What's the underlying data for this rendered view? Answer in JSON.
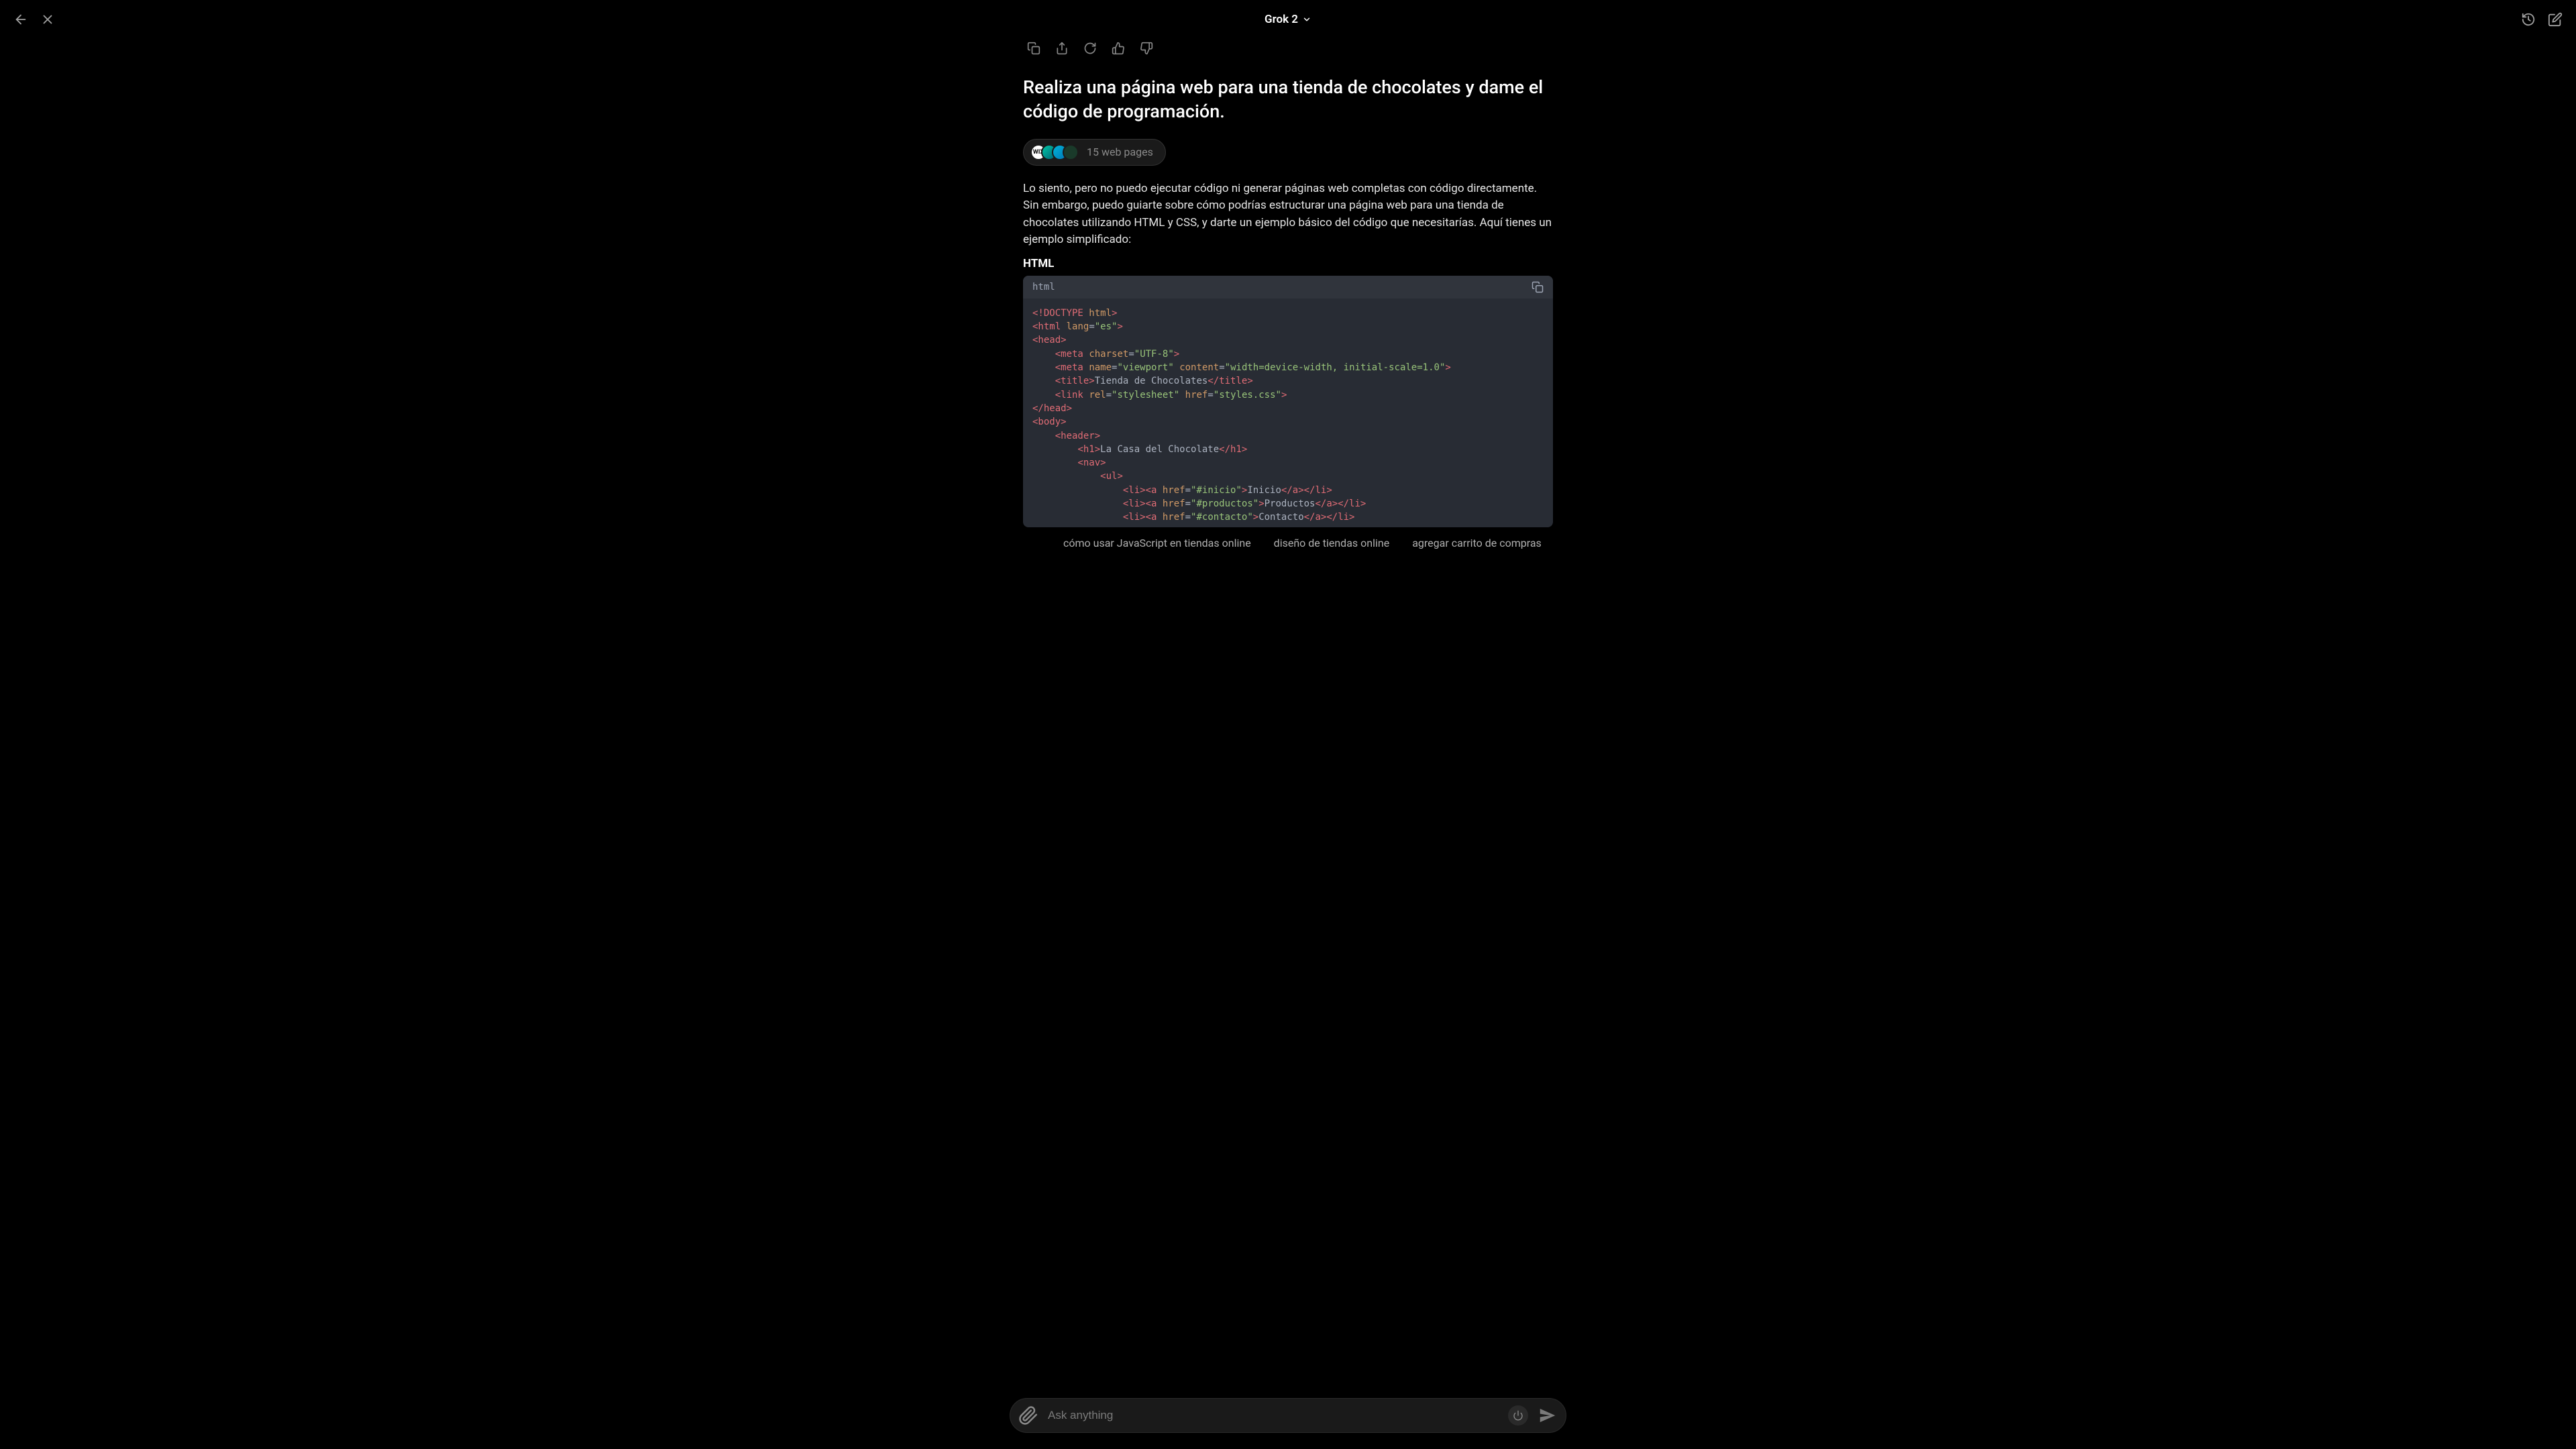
{
  "header": {
    "title": "Grok 2"
  },
  "actions": {},
  "prompt": "Realiza una página web para una tienda de chocolates y dame el código de programación.",
  "sources": {
    "wix_label": "WIX",
    "count_text": "15 web pages"
  },
  "response": {
    "intro": "Lo siento, pero no puedo ejecutar código ni generar páginas web completas con código directamente. Sin embargo, puedo guiarte sobre cómo podrías estructurar una página web para una tienda de chocolates utilizando HTML y CSS, y darte un ejemplo básico del código que necesitarías. Aquí tienes un ejemplo simplificado:",
    "section_label": "HTML",
    "code_lang": "html",
    "code_lines": [
      [
        [
          "tag",
          "<!DOCTYPE"
        ],
        [
          "pun",
          " "
        ],
        [
          "attr",
          "html"
        ],
        [
          "tag",
          ">"
        ]
      ],
      [
        [
          "tag",
          "<html"
        ],
        [
          "pun",
          " "
        ],
        [
          "attr",
          "lang"
        ],
        [
          "pun",
          "="
        ],
        [
          "str",
          "\"es\""
        ],
        [
          "tag",
          ">"
        ]
      ],
      [
        [
          "tag",
          "<head>"
        ]
      ],
      [
        [
          "pun",
          "    "
        ],
        [
          "tag",
          "<meta"
        ],
        [
          "pun",
          " "
        ],
        [
          "attr",
          "charset"
        ],
        [
          "pun",
          "="
        ],
        [
          "str",
          "\"UTF-8\""
        ],
        [
          "tag",
          ">"
        ]
      ],
      [
        [
          "pun",
          "    "
        ],
        [
          "tag",
          "<meta"
        ],
        [
          "pun",
          " "
        ],
        [
          "attr",
          "name"
        ],
        [
          "pun",
          "="
        ],
        [
          "str",
          "\"viewport\""
        ],
        [
          "pun",
          " "
        ],
        [
          "attr",
          "content"
        ],
        [
          "pun",
          "="
        ],
        [
          "str",
          "\"width=device-width, initial-scale=1.0\""
        ],
        [
          "tag",
          ">"
        ]
      ],
      [
        [
          "pun",
          "    "
        ],
        [
          "tag",
          "<title>"
        ],
        [
          "txt",
          "Tienda de Chocolates"
        ],
        [
          "tag",
          "</title>"
        ]
      ],
      [
        [
          "pun",
          "    "
        ],
        [
          "tag",
          "<link"
        ],
        [
          "pun",
          " "
        ],
        [
          "attr",
          "rel"
        ],
        [
          "pun",
          "="
        ],
        [
          "str",
          "\"stylesheet\""
        ],
        [
          "pun",
          " "
        ],
        [
          "attr",
          "href"
        ],
        [
          "pun",
          "="
        ],
        [
          "str",
          "\"styles.css\""
        ],
        [
          "tag",
          ">"
        ]
      ],
      [
        [
          "tag",
          "</head>"
        ]
      ],
      [
        [
          "tag",
          "<body>"
        ]
      ],
      [
        [
          "pun",
          "    "
        ],
        [
          "tag",
          "<header>"
        ]
      ],
      [
        [
          "pun",
          "        "
        ],
        [
          "tag",
          "<h1>"
        ],
        [
          "txt",
          "La Casa del Chocolate"
        ],
        [
          "tag",
          "</h1>"
        ]
      ],
      [
        [
          "pun",
          "        "
        ],
        [
          "tag",
          "<nav>"
        ]
      ],
      [
        [
          "pun",
          "            "
        ],
        [
          "tag",
          "<ul>"
        ]
      ],
      [
        [
          "pun",
          "                "
        ],
        [
          "tag",
          "<li><a"
        ],
        [
          "pun",
          " "
        ],
        [
          "attr",
          "href"
        ],
        [
          "pun",
          "="
        ],
        [
          "str",
          "\"#inicio\""
        ],
        [
          "tag",
          ">"
        ],
        [
          "txt",
          "Inicio"
        ],
        [
          "tag",
          "</a></li>"
        ]
      ],
      [
        [
          "pun",
          "                "
        ],
        [
          "tag",
          "<li><a"
        ],
        [
          "pun",
          " "
        ],
        [
          "attr",
          "href"
        ],
        [
          "pun",
          "="
        ],
        [
          "str",
          "\"#productos\""
        ],
        [
          "tag",
          ">"
        ],
        [
          "txt",
          "Productos"
        ],
        [
          "tag",
          "</a></li>"
        ]
      ],
      [
        [
          "pun",
          "                "
        ],
        [
          "tag",
          "<li><a"
        ],
        [
          "pun",
          " "
        ],
        [
          "attr",
          "href"
        ],
        [
          "pun",
          "="
        ],
        [
          "str",
          "\"#contacto\""
        ],
        [
          "tag",
          ">"
        ],
        [
          "txt",
          "Contacto"
        ],
        [
          "tag",
          "</a></li>"
        ]
      ]
    ]
  },
  "suggestions": [
    "cómo usar JavaScript en tiendas online",
    "diseño de tiendas online",
    "agregar carrito de compras"
  ],
  "input": {
    "placeholder": "Ask anything"
  }
}
